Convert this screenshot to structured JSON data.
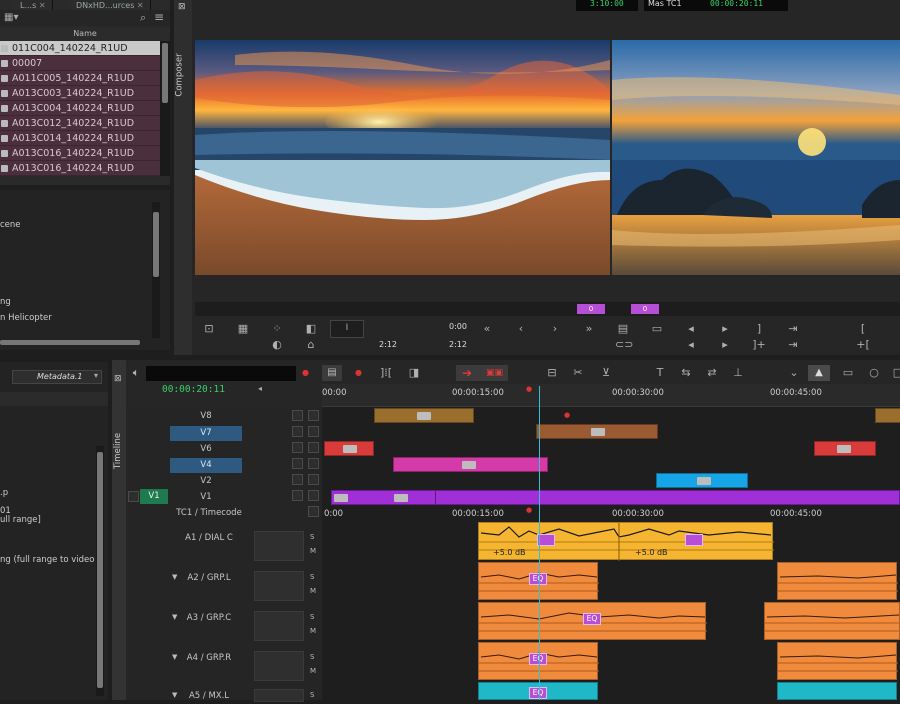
{
  "bin": {
    "tabs": [
      "L...s",
      "DNxHD...urces"
    ],
    "column_header": "Name",
    "items": [
      {
        "name": "011C004_140224_R1UD",
        "selected": true
      },
      {
        "name": "00007"
      },
      {
        "name": "A011C005_140224_R1UD"
      },
      {
        "name": "A013C003_140224_R1UD"
      },
      {
        "name": "A013C004_140224_R1UD"
      },
      {
        "name": "A013C012_140224_R1UD"
      },
      {
        "name": "A013C014_140224_R1UD"
      },
      {
        "name": "A013C016_140224_R1UD"
      },
      {
        "name": "A013C016_140224_R1UD"
      }
    ]
  },
  "lower_left": {
    "lines": [
      "cene",
      "ng",
      "n Helicopter"
    ]
  },
  "composer": {
    "label": "Composer",
    "top_timecode": "3:10:00",
    "right_label": "Mas TC1",
    "right_timecode": "00:00:20:11",
    "src_time_a": "0:00",
    "src_time_b": "2:12",
    "src_time_c": "2:12",
    "marker_a": "0",
    "marker_b": "0"
  },
  "metadata": {
    "dropdown": "Metadata.1",
    "lines": [
      ".p",
      "01",
      "ull range]",
      "ng (full range to video"
    ]
  },
  "timeline": {
    "label": "Timeline",
    "timecode": "00:00:20:11",
    "ruler": [
      "00:00",
      "00:00:15:00",
      "00:00:30:00",
      "00:00:45:00"
    ],
    "ruler2": [
      "0:00",
      "00:00:15:00",
      "00:00:30:00",
      "00:00:45:00"
    ],
    "record_track": "V1",
    "tracks": [
      "V8",
      "V7",
      "V6",
      "V4",
      "V2",
      "V1",
      "TC1 / Timecode",
      "A1 / DIAL C",
      "A2 / GRP.L",
      "A3 / GRP.C",
      "A4 / GRP.R",
      "A5 / MX.L"
    ],
    "sm": [
      "S",
      "M"
    ],
    "gain_a": "+5.0 dB",
    "gain_b": "+5.0 dB",
    "eq": "EQ"
  },
  "colors": {
    "audio_yellow": "#f5b530",
    "audio_orange": "#f08a3c",
    "audio_cyan": "#1fb8c8",
    "v1_purple": "#a02fd8",
    "v4_magenta": "#d43aa8",
    "v6_red": "#d93b3b",
    "v2_blue": "#16a6e8",
    "v7_brown": "#9a5a32",
    "v8_gold": "#9a6e2c",
    "playhead": "#2fc1d8",
    "timecode_green": "#38d06a"
  }
}
